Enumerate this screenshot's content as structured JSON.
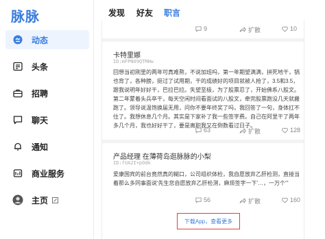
{
  "app": {
    "logo_text": "脉脉"
  },
  "sidebar": {
    "items": [
      {
        "label": "动态",
        "icon": "feed-icon",
        "active": true
      },
      {
        "label": "头条",
        "icon": "headline-icon",
        "active": false
      },
      {
        "label": "招聘",
        "icon": "briefcase-icon",
        "active": false
      },
      {
        "label": "聊天",
        "icon": "chat-icon",
        "active": false
      },
      {
        "label": "通知",
        "icon": "bell-icon",
        "active": false
      },
      {
        "label": "商业服务",
        "icon": "business-icon",
        "active": false
      },
      {
        "label": "主页",
        "icon": "avatar",
        "active": false
      }
    ]
  },
  "tabs": [
    {
      "label": "发现",
      "active": false
    },
    {
      "label": "好友",
      "active": false
    },
    {
      "label": "职言",
      "active": true
    }
  ],
  "posts": [
    {
      "actions": {
        "comment_count": "9",
        "forward_label": "扩散",
        "like_count": "10"
      }
    },
    {
      "author": "卡特里娜",
      "id": "ID:mFPN09QTMHw",
      "body": "回想当初刚里的两年可真难熬，不说加班吗，第一年期望满满，拼死地干，锅也背了，各种膀，挺过了试用期，干的成绩好的项目就被人抢了，3.5和3.5，跟我说明年好好干，巴拉巴拉。失望至极，为了股票忍了，开始佛系八股文。第二年蒙着头兵卒干，每天空闲时间看面试的八股文，牵完股票跑没几天就搬跑了。领导说温饱换届无用，问你不要年终奖了吗，我回答了一句，身体扛不住了。我想休息几个月。其实是下家补了我一些签字费。自己在阿里干了两年多几个月，我也好好干了，要是离职我又在倒数看过日子。",
      "actions": {
        "comment_count": "63",
        "forward_label": "扩散",
        "like_count": "128"
      }
    },
    {
      "author": "产品经理 在薄荷岛逛脉脉的小梨",
      "id": "ID:fUA2I+pOdk",
      "body": "爱康国宾的前台竟然真的糊口，公司组织体检，我自愿放弃乙肝检测，直接当着那么多同事面说'先生您自愿放弃乙肝检测，麻烦签字一下'…，一万个'''",
      "actions": {
        "comment_count": "56",
        "forward_label": "扩散",
        "like_count": "160"
      }
    }
  ],
  "cta": {
    "label": "下载App，查看更多"
  },
  "colors": {
    "accent": "#3a7ce0",
    "cta_border": "#e03d3d"
  }
}
